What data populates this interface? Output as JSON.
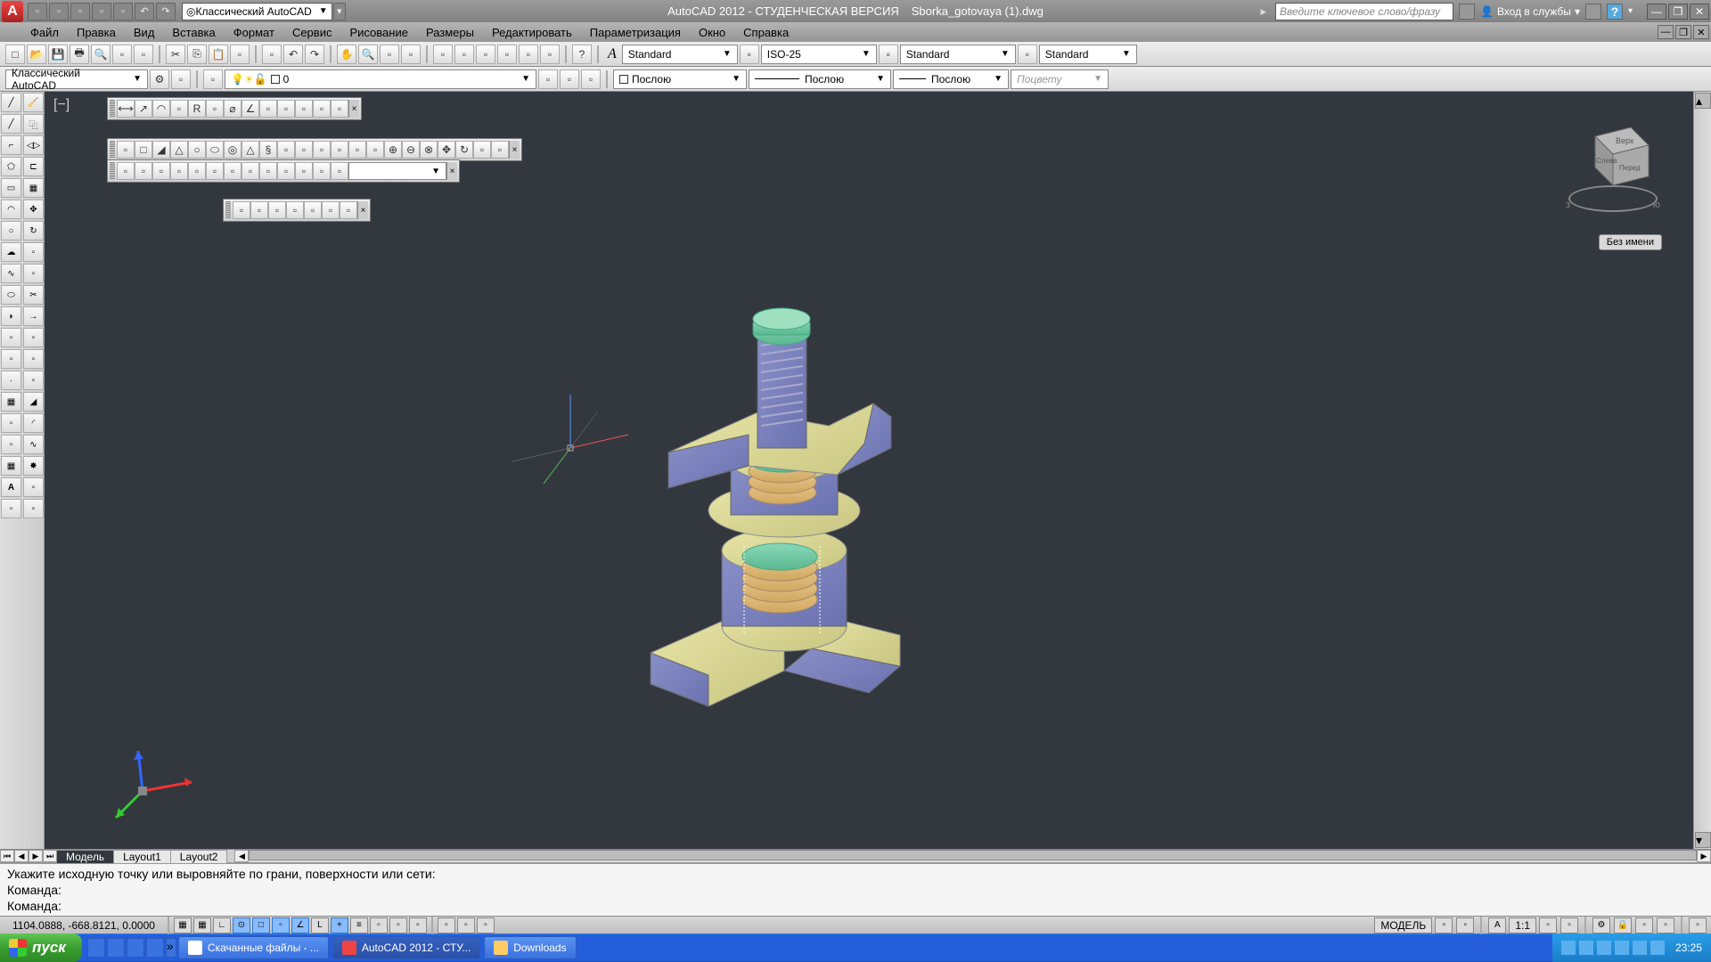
{
  "title": {
    "app": "AutoCAD 2012 - СТУДЕНЧЕСКАЯ ВЕРСИЯ",
    "file": "Sborka_gotovaya (1).dwg"
  },
  "workspace": "Классический AutoCAD",
  "search_placeholder": "Введите ключевое слово/фразу",
  "signin": "Вход в службы",
  "menu": [
    "Файл",
    "Правка",
    "Вид",
    "Вставка",
    "Формат",
    "Сервис",
    "Рисование",
    "Размеры",
    "Редактировать",
    "Параметризация",
    "Окно",
    "Справка"
  ],
  "styles": {
    "text": "Standard",
    "dim": "ISO-25",
    "table": "Standard",
    "mline": "Standard"
  },
  "workspace_combo2": "Классический AutoCAD",
  "layer": {
    "name": "0",
    "bylayer": "Послою"
  },
  "linetype": "Послою",
  "lineweight": "Послою",
  "plotstyle": "Поцвету",
  "viewcube": {
    "top": "Верх",
    "left": "Слева",
    "front": "Перед",
    "s": "з",
    "e": "ю"
  },
  "unnamed": "Без имени",
  "tabs": {
    "model": "Модель",
    "layout1": "Layout1",
    "layout2": "Layout2"
  },
  "cmd": {
    "line1": "Укажите исходную точку или выровняйте по грани, поверхности или сети:",
    "line2": "Команда:",
    "line3": "Команда:"
  },
  "status": {
    "coords": "1104.0888, -668.8121, 0.0000",
    "model": "МОДЕЛЬ",
    "scale": "1:1"
  },
  "taskbar": {
    "start": "пуск",
    "tasks": [
      {
        "label": "Скачанные файлы - ...",
        "active": false
      },
      {
        "label": "AutoCAD 2012 - СТУ...",
        "active": true
      },
      {
        "label": "Downloads",
        "active": false
      }
    ],
    "clock": "23:25"
  }
}
